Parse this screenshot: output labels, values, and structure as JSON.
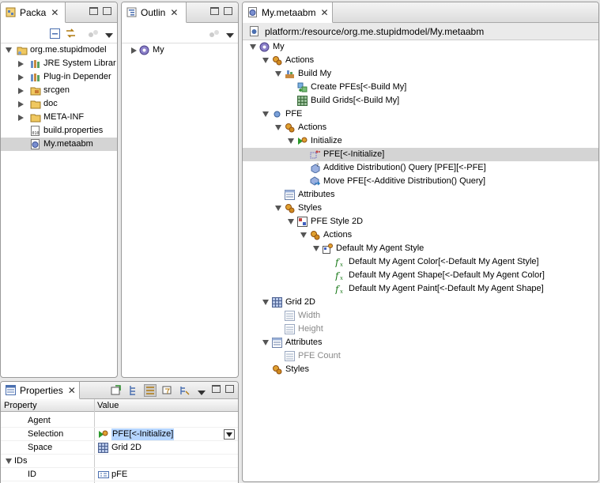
{
  "package_explorer": {
    "tab_label": "Packa",
    "items": [
      {
        "label": "org.me.stupidmodel",
        "icon": "project-icon"
      },
      {
        "label": "JRE System Librar",
        "icon": "library-icon"
      },
      {
        "label": "Plug-in Depender",
        "icon": "library-icon"
      },
      {
        "label": "srcgen",
        "icon": "source-folder-icon"
      },
      {
        "label": "doc",
        "icon": "folder-icon"
      },
      {
        "label": "META-INF",
        "icon": "folder-icon"
      },
      {
        "label": "build.properties",
        "icon": "properties-file-icon"
      },
      {
        "label": "My.metaabm",
        "icon": "metaabm-file-icon"
      }
    ]
  },
  "outline": {
    "tab_label": "Outlin",
    "items": [
      {
        "label": "My"
      }
    ]
  },
  "editor": {
    "tab_label": "My.metaabm",
    "path": "platform:/resource/org.me.stupidmodel/My.metaabm",
    "tree": [
      {
        "label": "My"
      },
      {
        "label": "Actions"
      },
      {
        "label": "Build My"
      },
      {
        "label": "Create PFEs[<-Build My]"
      },
      {
        "label": "Build Grids[<-Build My]"
      },
      {
        "label": "PFE"
      },
      {
        "label": "Actions"
      },
      {
        "label": "Initialize"
      },
      {
        "label": "PFE[<-Initialize]"
      },
      {
        "label": "Additive Distribution() Query [PFE][<-PFE]"
      },
      {
        "label": "Move PFE[<-Additive Distribution() Query]"
      },
      {
        "label": "Attributes"
      },
      {
        "label": "Styles"
      },
      {
        "label": "PFE Style 2D"
      },
      {
        "label": "Actions"
      },
      {
        "label": "Default My Agent Style"
      },
      {
        "label": "Default My Agent Color[<-Default My Agent Style]"
      },
      {
        "label": "Default My Agent Shape[<-Default My Agent Color]"
      },
      {
        "label": "Default My Agent Paint[<-Default My Agent Shape]"
      },
      {
        "label": "Grid 2D"
      },
      {
        "label": "Width"
      },
      {
        "label": "Height"
      },
      {
        "label": "Attributes"
      },
      {
        "label": "PFE Count"
      },
      {
        "label": "Styles"
      }
    ]
  },
  "properties": {
    "tab_label": "Properties",
    "columns": [
      "Property",
      "Value"
    ],
    "rows": [
      {
        "property": "Agent",
        "value": ""
      },
      {
        "property": "Selection",
        "value": "PFE[<-Initialize]"
      },
      {
        "property": "Space",
        "value": "Grid 2D"
      },
      {
        "property": "IDs",
        "value": ""
      },
      {
        "property": "ID",
        "value": "pFE"
      }
    ]
  },
  "colors": {
    "selection": "#d4d4d4",
    "highlight": "#b5d5ff"
  }
}
